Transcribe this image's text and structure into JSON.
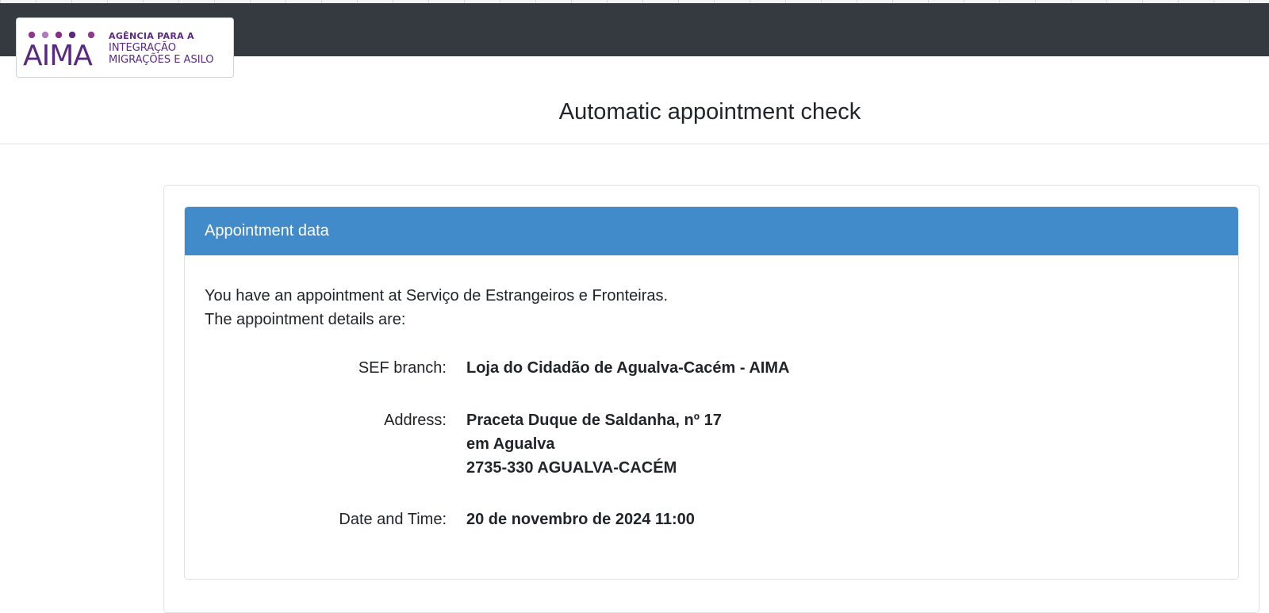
{
  "header": {
    "logo": {
      "wordmark": "AIMA",
      "line1": "AGÊNCIA PARA A",
      "line2": "INTEGRAÇÃO",
      "line3": "MIGRAÇÕES E ASILO",
      "brand_color": "#5a2a83"
    },
    "bar_color": "#343a40"
  },
  "page": {
    "title": "Automatic appointment check"
  },
  "card": {
    "header_title": "Appointment data",
    "header_color": "#428bca",
    "intro_line1": "You have an appointment at Serviço de Estrangeiros e Fronteiras.",
    "intro_line2": "The appointment details are:",
    "details": {
      "branch_label": "SEF branch:",
      "branch_value": "Loja do Cidadão de Agualva-Cacém - AIMA",
      "address_label": "Address:",
      "address_line1": "Praceta Duque de Saldanha, nº 17",
      "address_line2": "em Agualva",
      "address_line3": "2735-330 AGUALVA-CACÉM",
      "datetime_label": "Date and Time:",
      "datetime_value": "20 de novembro de 2024 11:00"
    }
  }
}
